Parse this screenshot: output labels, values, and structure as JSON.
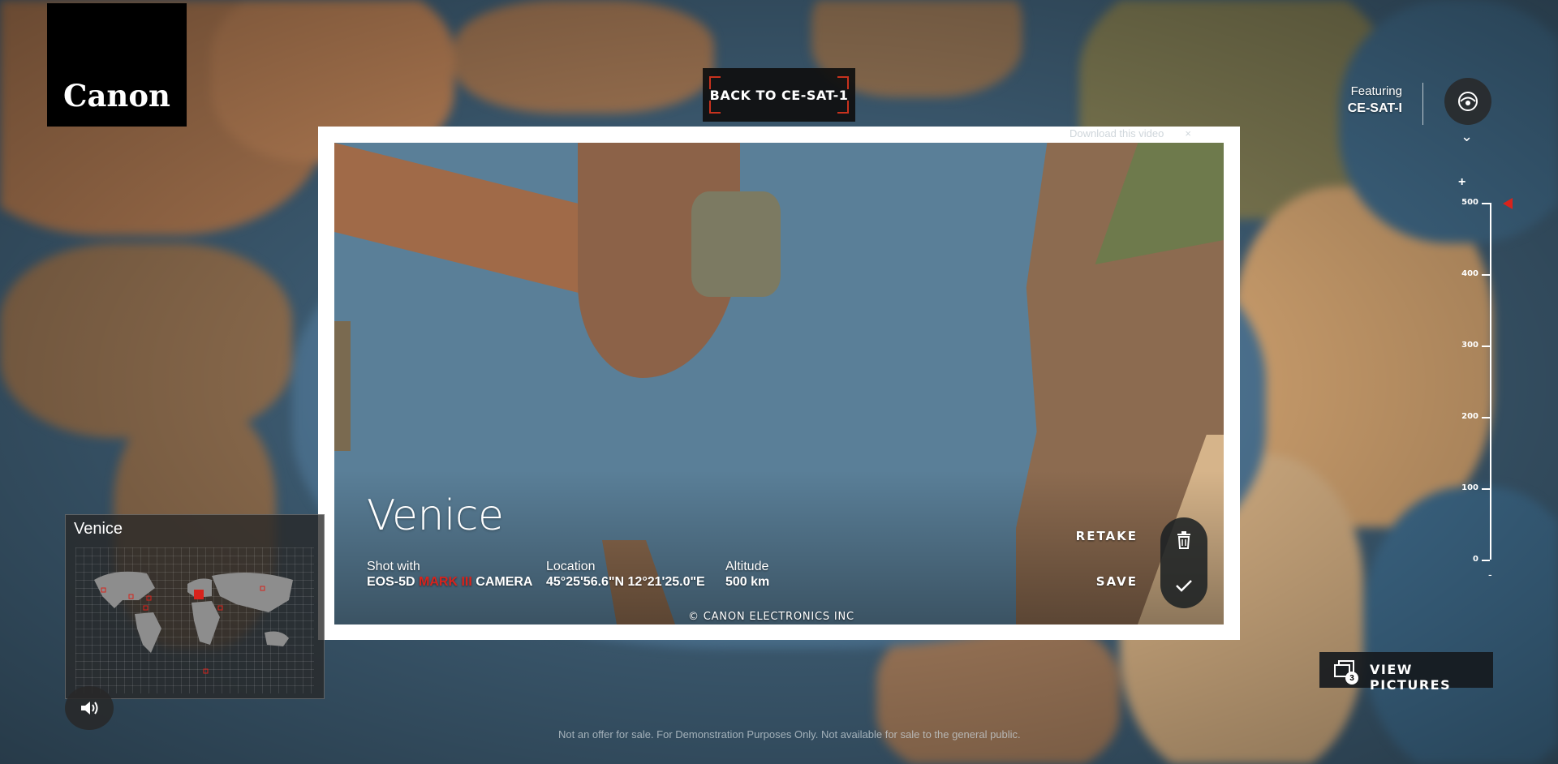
{
  "brand": {
    "logo_text": "Canon"
  },
  "header": {
    "back_button_label": "BACK TO CE-SAT-1",
    "featuring_label": "Featuring",
    "featuring_value": "CE-SAT-I"
  },
  "altitude_scale": {
    "plus": "+",
    "minus": "-",
    "ticks": [
      "500",
      "400",
      "300",
      "200",
      "100",
      "0"
    ],
    "current_value": 500
  },
  "photo": {
    "download_link": "Download this video",
    "close": "×",
    "title": "Venice",
    "shot_with_label": "Shot with",
    "camera_prefix": "EOS-5D",
    "camera_highlight": "MARK III",
    "camera_suffix": "CAMERA",
    "location_label": "Location",
    "location_value": "45°25'56.6\"N 12°21'25.0\"E",
    "altitude_label": "Altitude",
    "altitude_value": "500 km",
    "copyright": "© CANON ELECTRONICS INC",
    "retake_label": "RETAKE",
    "save_label": "SAVE"
  },
  "minimap": {
    "label": "Venice"
  },
  "view_pictures": {
    "label": "VIEW PICTURES",
    "count": "3"
  },
  "footer": {
    "disclaimer": "Not an offer for sale. For Demonstration Purposes Only. Not available for sale to the general public."
  },
  "colors": {
    "accent": "#d8231c",
    "card": "#ffffff",
    "panel": "#1a1e22"
  },
  "icons": [
    "satellite-icon",
    "chevron-down-icon",
    "trash-icon",
    "check-icon",
    "sound-icon",
    "gallery-icon",
    "world-map-icon"
  ]
}
